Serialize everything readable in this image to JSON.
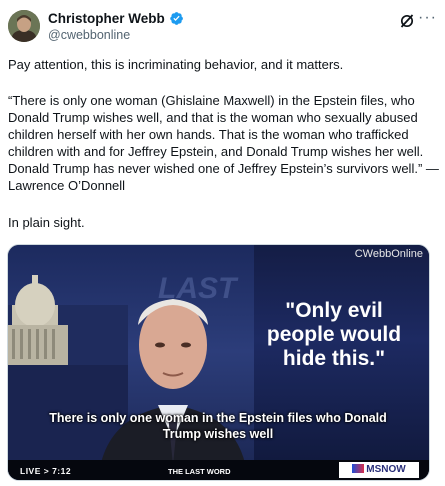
{
  "author": {
    "name": "Christopher Webb",
    "handle": "@cwebbonline"
  },
  "icons": {
    "verified": "verified-badge-icon",
    "grok": "grok-icon",
    "more": "more-icon",
    "more_glyph": "···"
  },
  "colors": {
    "verified_blue": "#1d9bf0",
    "text_primary": "#0f1419",
    "text_secondary": "#536471"
  },
  "post": {
    "line1": "Pay attention, this is incriminating behavior, and it matters.",
    "quote": "“There is only one woman (Ghislaine Maxwell) in the Epstein files, who Donald Trump wishes well, and that is the woman who sexually abused children herself with her own hands. That is the woman who trafficked children with and for Jeffrey Epstein, and Donald Trump wishes her well. Donald Trump has never wished one of Jeffrey Epstein’s survivors well.” — Lawrence O’Donnell",
    "line3": "In plain sight."
  },
  "media": {
    "watermark": "CWebbOnline",
    "background_text": "LAST",
    "quote_card": "\"Only evil people would hide this.\"",
    "caption": "There is only one woman in the Epstein files who Donald Trump wishes well",
    "live_label": "LIVE > 7:12",
    "show_title": "THE LAST WORD",
    "network": "MSNOW"
  }
}
